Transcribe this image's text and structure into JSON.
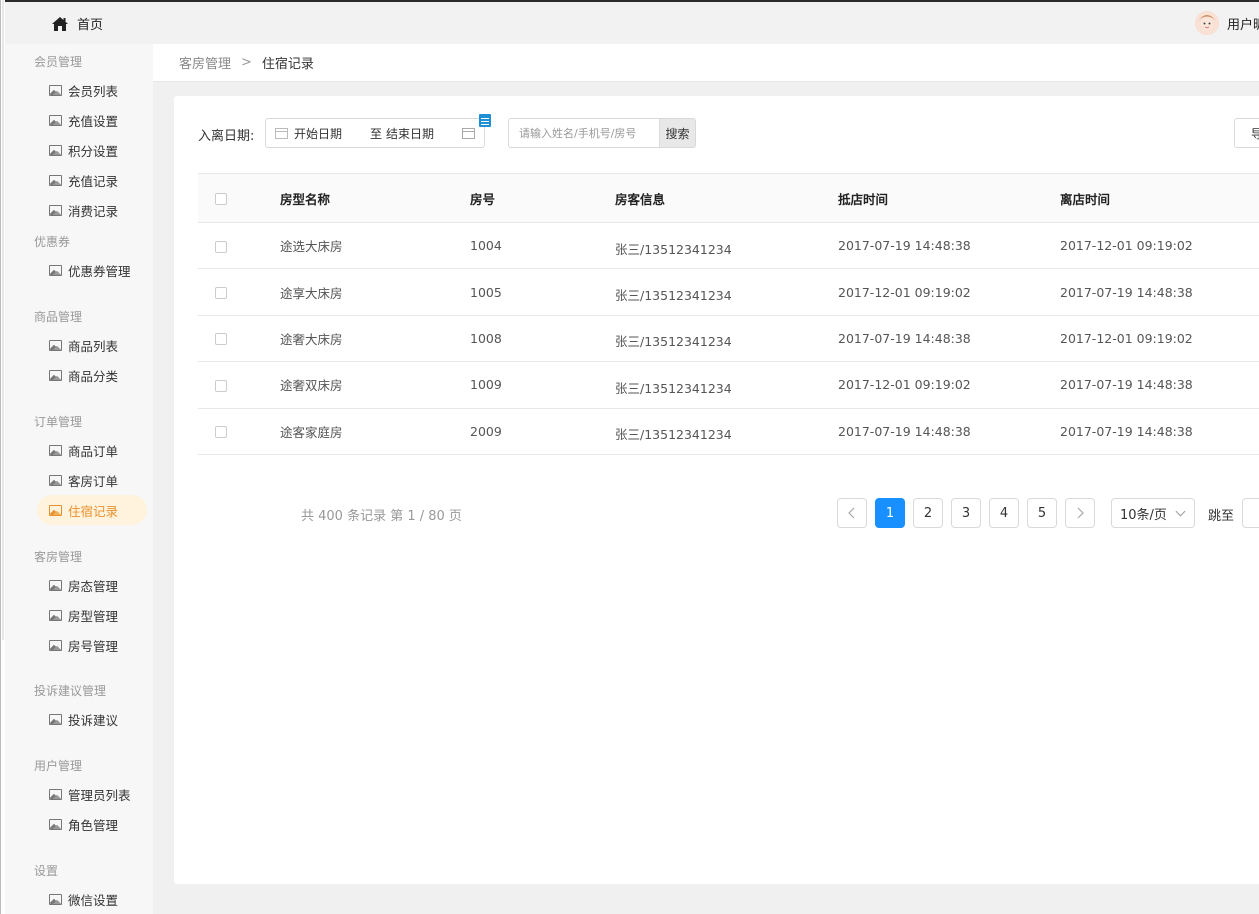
{
  "header": {
    "home_label": "首页",
    "user_name": "用户昵称"
  },
  "sidebar": {
    "groups": [
      {
        "title": "会员管理",
        "items": [
          "会员列表",
          "充值设置",
          "积分设置",
          "充值记录",
          "消费记录"
        ]
      },
      {
        "title": "优惠券",
        "items": [
          "优惠券管理"
        ]
      },
      {
        "title": "商品管理",
        "items": [
          "商品列表",
          "商品分类"
        ]
      },
      {
        "title": "订单管理",
        "items": [
          "商品订单",
          "客房订单",
          "住宿记录"
        ]
      },
      {
        "title": "客房管理",
        "items": [
          "房态管理",
          "房型管理",
          "房号管理"
        ]
      },
      {
        "title": "投诉建议管理",
        "items": [
          "投诉建议"
        ]
      },
      {
        "title": "用户管理",
        "items": [
          "管理员列表",
          "角色管理"
        ]
      },
      {
        "title": "设置",
        "items": [
          "微信设置"
        ]
      }
    ],
    "active_item": "住宿记录",
    "accent_color": "#e8902c"
  },
  "breadcrumb": {
    "parent": "客房管理",
    "separator": ">",
    "current": "住宿记录"
  },
  "filters": {
    "date_label": "入离日期:",
    "start_placeholder": "开始日期",
    "range_separator": "至",
    "end_placeholder": "结束日期",
    "search_placeholder": "请输入姓名/手机号/房号",
    "search_button": "搜索",
    "export_button": "导出"
  },
  "table": {
    "columns": [
      "房型名称",
      "房号",
      "房客信息",
      "抵店时间",
      "离店时间"
    ],
    "rows": [
      {
        "room_type": "途选大床房",
        "room_no": "1004",
        "guest": "张三/13512341234",
        "check_in": "2017-07-19 14:48:38",
        "check_out": "2017-12-01 09:19:02"
      },
      {
        "room_type": "途享大床房",
        "room_no": "1005",
        "guest": "张三/13512341234",
        "check_in": "2017-12-01 09:19:02",
        "check_out": "2017-07-19 14:48:38"
      },
      {
        "room_type": "途奢大床房",
        "room_no": "1008",
        "guest": "张三/13512341234",
        "check_in": "2017-07-19 14:48:38",
        "check_out": "2017-12-01 09:19:02"
      },
      {
        "room_type": "途奢双床房",
        "room_no": "1009",
        "guest": "张三/13512341234",
        "check_in": "2017-12-01 09:19:02",
        "check_out": "2017-07-19 14:48:38"
      },
      {
        "room_type": "途客家庭房",
        "room_no": "2009",
        "guest": "张三/13512341234",
        "check_in": "2017-07-19 14:48:38",
        "check_out": "2017-07-19 14:48:38"
      }
    ]
  },
  "pagination": {
    "summary": "共 400 条记录 第 1 / 80 页",
    "pages": [
      "1",
      "2",
      "3",
      "4",
      "5"
    ],
    "current_page": "1",
    "page_size": "10条/页",
    "jump_label": "跳至",
    "accent_color": "#1890ff"
  }
}
